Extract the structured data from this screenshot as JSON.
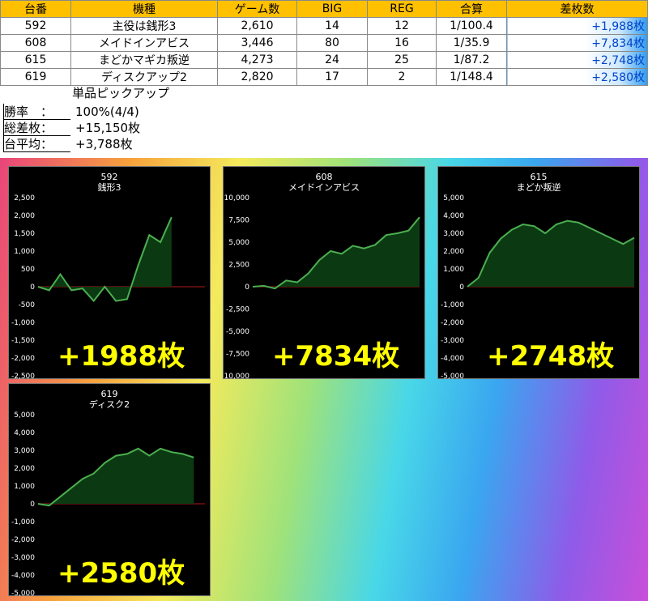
{
  "table": {
    "headers": [
      "台番",
      "機種",
      "ゲーム数",
      "BIG",
      "REG",
      "合算",
      "差枚数"
    ],
    "rows": [
      [
        "592",
        "主役は銭形3",
        "2,610",
        "14",
        "12",
        "1/100.4",
        "+1,988枚"
      ],
      [
        "608",
        "メイドインアビス",
        "3,446",
        "80",
        "16",
        "1/35.9",
        "+7,834枚"
      ],
      [
        "615",
        "まどかマギカ叛逆",
        "4,273",
        "24",
        "25",
        "1/87.2",
        "+2,748枚"
      ],
      [
        "619",
        "ディスクアップ2",
        "2,820",
        "17",
        "2",
        "1/148.4",
        "+2,580枚"
      ]
    ]
  },
  "pickup_label": "単品ピックアップ",
  "summary": [
    {
      "k": "勝率　：",
      "v": "100%(4/4)"
    },
    {
      "k": "総差枚：",
      "v": "+15,150枚"
    },
    {
      "k": "台平均：",
      "v": "+3,788枚"
    }
  ],
  "colors": {
    "line": "#4caf50",
    "fill": "#0b3a12",
    "zero": "#b01818",
    "text": "#ffffff",
    "big": "#ffff00"
  },
  "chart_data": [
    {
      "type": "area",
      "title": "592",
      "subtitle": "銭形3",
      "ylim": [
        -2500,
        2500
      ],
      "yticks": [
        "2,500",
        "2,000",
        "1,500",
        "1,000",
        "500",
        "0",
        "-500",
        "-1,000",
        "-1,500",
        "-2,000",
        "-2,500"
      ],
      "x": [
        0,
        1,
        2,
        3,
        4,
        5,
        6,
        7,
        8,
        9,
        10,
        11,
        12,
        13,
        14,
        15
      ],
      "values": [
        0,
        -100,
        350,
        -100,
        -50,
        -400,
        0,
        -400,
        -350,
        600,
        1450,
        1250,
        1950,
        null,
        null,
        null
      ],
      "label": "+1988枚"
    },
    {
      "type": "area",
      "title": "608",
      "subtitle": "メイドインアビス",
      "ylim": [
        -10000,
        10000
      ],
      "yticks": [
        "10,000",
        "7,500",
        "5,000",
        "2,500",
        "0",
        "-2,500",
        "-5,000",
        "-7,500",
        "-10,000"
      ],
      "x": [
        0,
        1,
        2,
        3,
        4,
        5,
        6,
        7,
        8,
        9,
        10,
        11,
        12,
        13,
        14,
        15
      ],
      "values": [
        0,
        100,
        -200,
        700,
        500,
        1500,
        3000,
        4000,
        3700,
        4600,
        4300,
        4700,
        5800,
        6000,
        6300,
        7800
      ],
      "label": "+7834枚"
    },
    {
      "type": "area",
      "title": "615",
      "subtitle": "まどか叛逆",
      "ylim": [
        -5000,
        5000
      ],
      "yticks": [
        "5,000",
        "4,000",
        "3,000",
        "2,000",
        "1,000",
        "0",
        "-1,000",
        "-2,000",
        "-3,000",
        "-4,000",
        "-5,000"
      ],
      "x": [
        0,
        1,
        2,
        3,
        4,
        5,
        6,
        7,
        8,
        9,
        10,
        11,
        12,
        13,
        14,
        15
      ],
      "values": [
        0,
        500,
        1900,
        2700,
        3200,
        3500,
        3400,
        3000,
        3500,
        3700,
        3600,
        3300,
        3000,
        2700,
        2400,
        2750
      ],
      "label": "+2748枚"
    },
    {
      "type": "area",
      "title": "619",
      "subtitle": "ディスク2",
      "ylim": [
        -5000,
        5000
      ],
      "yticks": [
        "5,000",
        "4,000",
        "3,000",
        "2,000",
        "1,000",
        "0",
        "-1,000",
        "-2,000",
        "-3,000",
        "-4,000",
        "-5,000"
      ],
      "x": [
        0,
        1,
        2,
        3,
        4,
        5,
        6,
        7,
        8,
        9,
        10,
        11,
        12,
        13,
        14
      ],
      "values": [
        0,
        -100,
        400,
        900,
        1400,
        1700,
        2300,
        2700,
        2800,
        3100,
        2700,
        3100,
        2900,
        2800,
        2600
      ],
      "label": "+2580枚"
    }
  ]
}
